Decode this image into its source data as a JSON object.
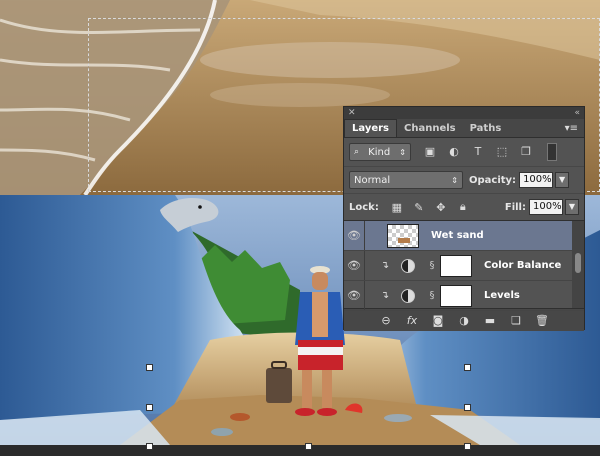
{
  "panel": {
    "tabs": [
      {
        "label": "Layers"
      },
      {
        "label": "Channels"
      },
      {
        "label": "Paths"
      }
    ],
    "filter": {
      "kind_label": "Kind"
    },
    "blend_mode": "Normal",
    "opacity": {
      "label": "Opacity:",
      "value": "100%"
    },
    "lock_label": "Lock:",
    "fill": {
      "label": "Fill:",
      "value": "100%"
    },
    "layers": [
      {
        "name": "Wet sand",
        "selected": true,
        "type": "pixel"
      },
      {
        "name": "Color Balance",
        "selected": false,
        "type": "adjustment"
      },
      {
        "name": "Levels",
        "selected": false,
        "type": "adjustment"
      }
    ],
    "bottom_icons": [
      "link-icon",
      "fx-icon",
      "mask-icon",
      "adjustment-icon",
      "folder-icon",
      "new-layer-icon",
      "trash-icon"
    ]
  },
  "colors": {
    "panel_bg": "#535353",
    "selected_layer": "#6b7790",
    "sky": "#5d83b8",
    "sand": "#b48c57"
  }
}
